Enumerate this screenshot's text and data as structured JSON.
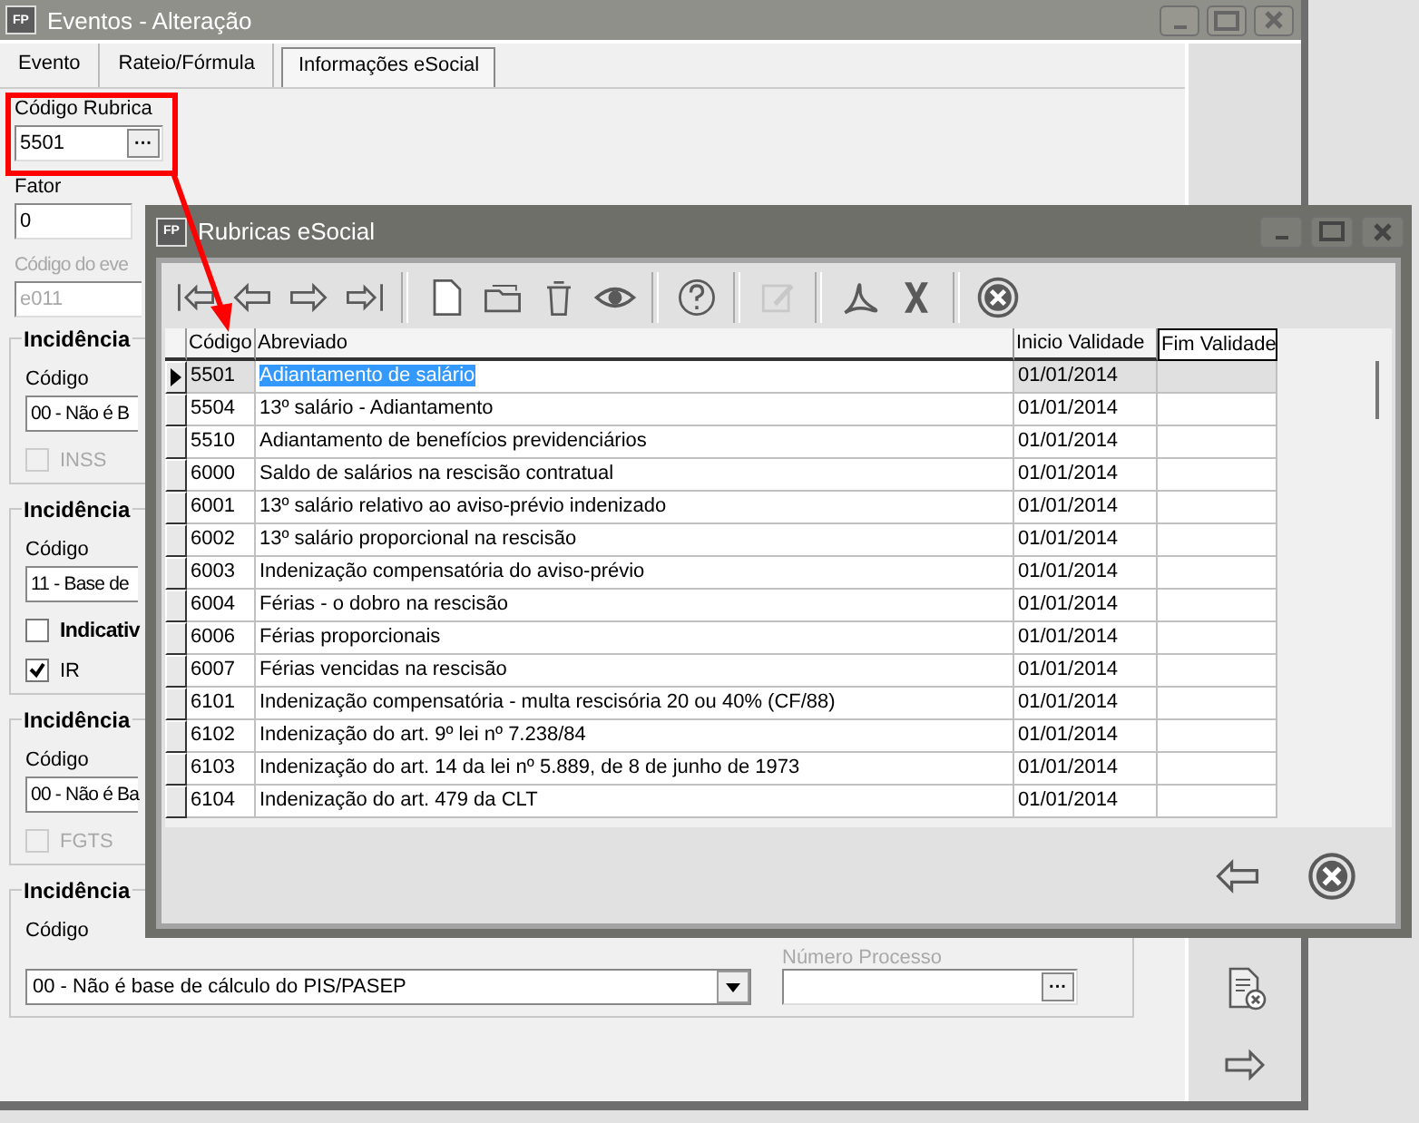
{
  "window": {
    "icon": "FP",
    "title": "Eventos - Alteração"
  },
  "tabs": [
    {
      "label": "Evento",
      "selected": false
    },
    {
      "label": "Rateio/Fórmula",
      "selected": false
    },
    {
      "label": "Informações eSocial",
      "selected": true
    }
  ],
  "form": {
    "rubrica": {
      "label": "Código Rubrica",
      "value": "5501",
      "button": "···"
    },
    "fator": {
      "label": "Fator",
      "value": "0"
    },
    "evento": {
      "label": "Código do eve",
      "value": "e011",
      "disabled": true
    }
  },
  "groups": [
    {
      "title": "Incidência",
      "code_label": "Código",
      "combo": "00 - Não é B",
      "checks": [
        {
          "label": "INSS",
          "checked": false,
          "disabled": true
        }
      ]
    },
    {
      "title": "Incidência",
      "code_label": "Código",
      "combo": "11 - Base de",
      "checks": [
        {
          "label": "Indicativ",
          "checked": false,
          "disabled": false,
          "bold": true
        },
        {
          "label": "IR",
          "checked": true,
          "disabled": false
        }
      ]
    },
    {
      "title": "Incidência",
      "code_label": "Código",
      "combo": "00 - Não é Ba",
      "checks": [
        {
          "label": "FGTS",
          "checked": false,
          "disabled": true
        }
      ]
    },
    {
      "title": "Incidência",
      "code_label": "Código",
      "combo": "00 - Não é base de cálculo do PIS/PASEP",
      "dropdown": true,
      "process": {
        "label": "Número Processo",
        "button": "···"
      }
    }
  ],
  "side_toolbar": [
    {
      "kind": "doc-cancel"
    },
    {
      "kind": "next"
    }
  ],
  "dialog": {
    "icon": "FP",
    "title": "Rubricas eSocial",
    "toolbar": [
      {
        "kind": "first",
        "disabled": false
      },
      {
        "kind": "prev",
        "disabled": false
      },
      {
        "kind": "next",
        "disabled": false
      },
      {
        "kind": "last",
        "disabled": false
      },
      {
        "kind": "separator"
      },
      {
        "kind": "new",
        "disabled": false
      },
      {
        "kind": "folder",
        "disabled": false
      },
      {
        "kind": "trash",
        "disabled": false
      },
      {
        "kind": "eye",
        "disabled": false
      },
      {
        "kind": "separator"
      },
      {
        "kind": "help",
        "disabled": false
      },
      {
        "kind": "separator"
      },
      {
        "kind": "edit",
        "disabled": true
      },
      {
        "kind": "separator"
      },
      {
        "kind": "pdf",
        "disabled": false
      },
      {
        "kind": "excel",
        "disabled": false
      },
      {
        "kind": "separator"
      },
      {
        "kind": "cancel",
        "disabled": false
      }
    ],
    "columns": [
      "Código",
      "Abreviado",
      "Inicio Validade",
      "Fim Validade"
    ],
    "rows": [
      {
        "code": "5501",
        "name": "Adiantamento de salário",
        "start": "01/01/2014",
        "selected": true
      },
      {
        "code": "5504",
        "name": "13º salário - Adiantamento",
        "start": "01/01/2014",
        "selected": false
      },
      {
        "code": "5510",
        "name": "Adiantamento de benefícios previdenciários",
        "start": "01/01/2014",
        "selected": false
      },
      {
        "code": "6000",
        "name": "Saldo de salários na rescisão contratual",
        "start": "01/01/2014",
        "selected": false
      },
      {
        "code": "6001",
        "name": "13º salário relativo ao aviso-prévio indenizado",
        "start": "01/01/2014",
        "selected": false
      },
      {
        "code": "6002",
        "name": "13º salário proporcional na rescisão",
        "start": "01/01/2014",
        "selected": false
      },
      {
        "code": "6003",
        "name": "Indenização compensatória do aviso-prévio",
        "start": "01/01/2014",
        "selected": false
      },
      {
        "code": "6004",
        "name": "Férias - o dobro na rescisão",
        "start": "01/01/2014",
        "selected": false
      },
      {
        "code": "6006",
        "name": "Férias proporcionais",
        "start": "01/01/2014",
        "selected": false
      },
      {
        "code": "6007",
        "name": "Férias vencidas na rescisão",
        "start": "01/01/2014",
        "selected": false
      },
      {
        "code": "6101",
        "name": "Indenização compensatória - multa rescisória 20 ou 40% (CF/88)",
        "start": "01/01/2014",
        "selected": false
      },
      {
        "code": "6102",
        "name": "Indenização do art. 9º lei nº 7.238/84",
        "start": "01/01/2014",
        "selected": false
      },
      {
        "code": "6103",
        "name": "Indenização do art. 14 da lei nº 5.889, de 8 de junho de 1973",
        "start": "01/01/2014",
        "selected": false
      },
      {
        "code": "6104",
        "name": "Indenização do art. 479 da CLT",
        "start": "01/01/2014",
        "selected": false
      }
    ],
    "bottom_buttons": [
      {
        "kind": "back"
      },
      {
        "kind": "cancel"
      }
    ]
  }
}
